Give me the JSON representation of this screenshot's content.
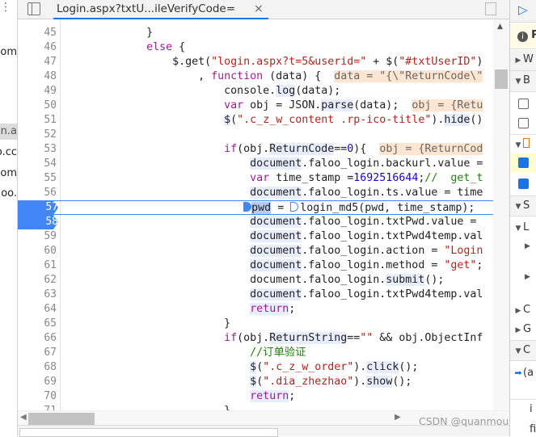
{
  "left_panel": {
    "items": [
      "com",
      "in.a",
      "o.cc",
      "om",
      "oo."
    ]
  },
  "tab": {
    "title": "Login.aspx?txtU...ileVerifyCode=",
    "close": "×"
  },
  "code_lines": [
    {
      "n": "45",
      "t": [
        [
          "p",
          "             }"
        ]
      ]
    },
    {
      "n": "46",
      "t": [
        [
          "p",
          "             "
        ],
        [
          "k",
          "else"
        ],
        [
          "p",
          " {"
        ]
      ]
    },
    {
      "n": "47",
      "t": [
        [
          "p",
          "                 $.get("
        ],
        [
          "s",
          "\"login.aspx?t=5&userid=\""
        ],
        [
          "p",
          " + $("
        ],
        [
          "s",
          "\"#txtUserID\""
        ],
        [
          "p",
          ")"
        ]
      ]
    },
    {
      "n": "48",
      "t": [
        [
          "p",
          "                     , "
        ],
        [
          "k",
          "function"
        ],
        [
          "p",
          " (data) {  "
        ],
        [
          "a",
          "data = \"{\\\"ReturnCode\\\""
        ]
      ]
    },
    {
      "n": "49",
      "t": [
        [
          "p",
          "                         console."
        ],
        [
          "h",
          "log"
        ],
        [
          "p",
          "(data);"
        ]
      ]
    },
    {
      "n": "50",
      "t": [
        [
          "p",
          "                         "
        ],
        [
          "k",
          "var"
        ],
        [
          "p",
          " obj = JSON."
        ],
        [
          "h",
          "parse"
        ],
        [
          "p",
          "(data);  "
        ],
        [
          "a",
          "obj = {Retu"
        ]
      ]
    },
    {
      "n": "51",
      "t": [
        [
          "p",
          "                         "
        ],
        [
          "h",
          "$"
        ],
        [
          "p",
          "("
        ],
        [
          "s",
          "\".c_z_w_content .rp-ico-title\""
        ],
        [
          "p",
          ")."
        ],
        [
          "h",
          "hide"
        ],
        [
          "p",
          "()"
        ]
      ]
    },
    {
      "n": "52",
      "t": []
    },
    {
      "n": "53",
      "t": [
        [
          "p",
          "                         "
        ],
        [
          "k",
          "if"
        ],
        [
          "p",
          "(obj."
        ],
        [
          "h",
          "ReturnCode"
        ],
        [
          "p",
          "=="
        ],
        [
          "n",
          "0"
        ],
        [
          "p",
          "){  "
        ],
        [
          "a",
          "obj = {ReturnCod"
        ]
      ]
    },
    {
      "n": "54",
      "t": [
        [
          "p",
          "                             "
        ],
        [
          "h",
          "document"
        ],
        [
          "p",
          ".faloo_login.backurl.value ="
        ]
      ]
    },
    {
      "n": "55",
      "t": [
        [
          "p",
          "                             "
        ],
        [
          "k",
          "var"
        ],
        [
          "p",
          " time_stamp ="
        ],
        [
          "n",
          "1692516644"
        ],
        [
          "p",
          ";"
        ],
        [
          "c",
          "//  get_t"
        ]
      ]
    },
    {
      "n": "56",
      "t": [
        [
          "p",
          "                             "
        ],
        [
          "h",
          "document"
        ],
        [
          "p",
          ".faloo_login.ts.value = time"
        ]
      ]
    },
    {
      "n": "57",
      "bp": true,
      "current": true,
      "t": [
        [
          "p",
          "                            "
        ],
        [
          "bpf",
          ""
        ],
        [
          "hd",
          "pwd"
        ],
        [
          "p",
          " = "
        ],
        [
          "bp",
          ""
        ],
        [
          "p",
          "login_md5(pwd, time_stamp);"
        ]
      ]
    },
    {
      "n": "58",
      "bp": true,
      "t": [
        [
          "p",
          "                             "
        ],
        [
          "h",
          "document"
        ],
        [
          "p",
          ".faloo_login.txtPwd.value ="
        ]
      ]
    },
    {
      "n": "59",
      "t": [
        [
          "p",
          "                             "
        ],
        [
          "h",
          "document"
        ],
        [
          "p",
          ".faloo_login.txtPwd4temp.val"
        ]
      ]
    },
    {
      "n": "60",
      "t": [
        [
          "p",
          "                             "
        ],
        [
          "h",
          "document"
        ],
        [
          "p",
          ".faloo_login.action = "
        ],
        [
          "s",
          "\"Login"
        ]
      ]
    },
    {
      "n": "61",
      "t": [
        [
          "p",
          "                             "
        ],
        [
          "h",
          "document"
        ],
        [
          "p",
          ".faloo_login.method = "
        ],
        [
          "s",
          "\"get\""
        ],
        [
          "p",
          ";"
        ]
      ]
    },
    {
      "n": "62",
      "t": [
        [
          "p",
          "                             document.faloo_login."
        ],
        [
          "h",
          "submit"
        ],
        [
          "p",
          "();"
        ]
      ]
    },
    {
      "n": "63",
      "t": [
        [
          "p",
          "                             "
        ],
        [
          "h",
          "document"
        ],
        [
          "p",
          ".faloo_login.txtPwd4temp.val"
        ]
      ]
    },
    {
      "n": "64",
      "t": [
        [
          "p",
          "                             "
        ],
        [
          "hk",
          "return"
        ],
        [
          "p",
          ";"
        ]
      ]
    },
    {
      "n": "65",
      "t": [
        [
          "p",
          "                         }"
        ]
      ]
    },
    {
      "n": "66",
      "t": [
        [
          "p",
          "                         "
        ],
        [
          "k",
          "if"
        ],
        [
          "p",
          "(obj."
        ],
        [
          "h",
          "ReturnString"
        ],
        [
          "p",
          "=="
        ],
        [
          "s",
          "\"\""
        ],
        [
          "p",
          " && obj.ObjectInf"
        ]
      ]
    },
    {
      "n": "67",
      "t": [
        [
          "p",
          "                             "
        ],
        [
          "c",
          "//订单验证"
        ]
      ]
    },
    {
      "n": "68",
      "t": [
        [
          "p",
          "                             "
        ],
        [
          "h",
          "$"
        ],
        [
          "p",
          "("
        ],
        [
          "s",
          "\".c_z_w_order\""
        ],
        [
          "p",
          ")."
        ],
        [
          "h",
          "click"
        ],
        [
          "p",
          "();"
        ]
      ]
    },
    {
      "n": "69",
      "t": [
        [
          "p",
          "                             "
        ],
        [
          "h",
          "$"
        ],
        [
          "p",
          "("
        ],
        [
          "s",
          "\".dia_zhezhao\""
        ],
        [
          "p",
          ")."
        ],
        [
          "h",
          "show"
        ],
        [
          "p",
          "();"
        ]
      ]
    },
    {
      "n": "70",
      "t": [
        [
          "p",
          "                             "
        ],
        [
          "hk",
          "return"
        ],
        [
          "p",
          ";"
        ]
      ]
    },
    {
      "n": "71",
      "t": [
        [
          "p",
          "                         }"
        ]
      ]
    }
  ],
  "right_panel": {
    "paused": "P",
    "watch": "W",
    "breakpoints": "B",
    "scope": "S",
    "local": "L",
    "closure": "C",
    "global": "G",
    "callstack": "C",
    "frame": "(a",
    "item1": "i",
    "item2": "fi"
  },
  "watermark": "CSDN @quanmoupy",
  "colors": {
    "accent": "#1a73e8",
    "breakpoint": "#4285f4",
    "annotation_bg": "#fde6d1",
    "paused_bg": "#fffbe5"
  }
}
